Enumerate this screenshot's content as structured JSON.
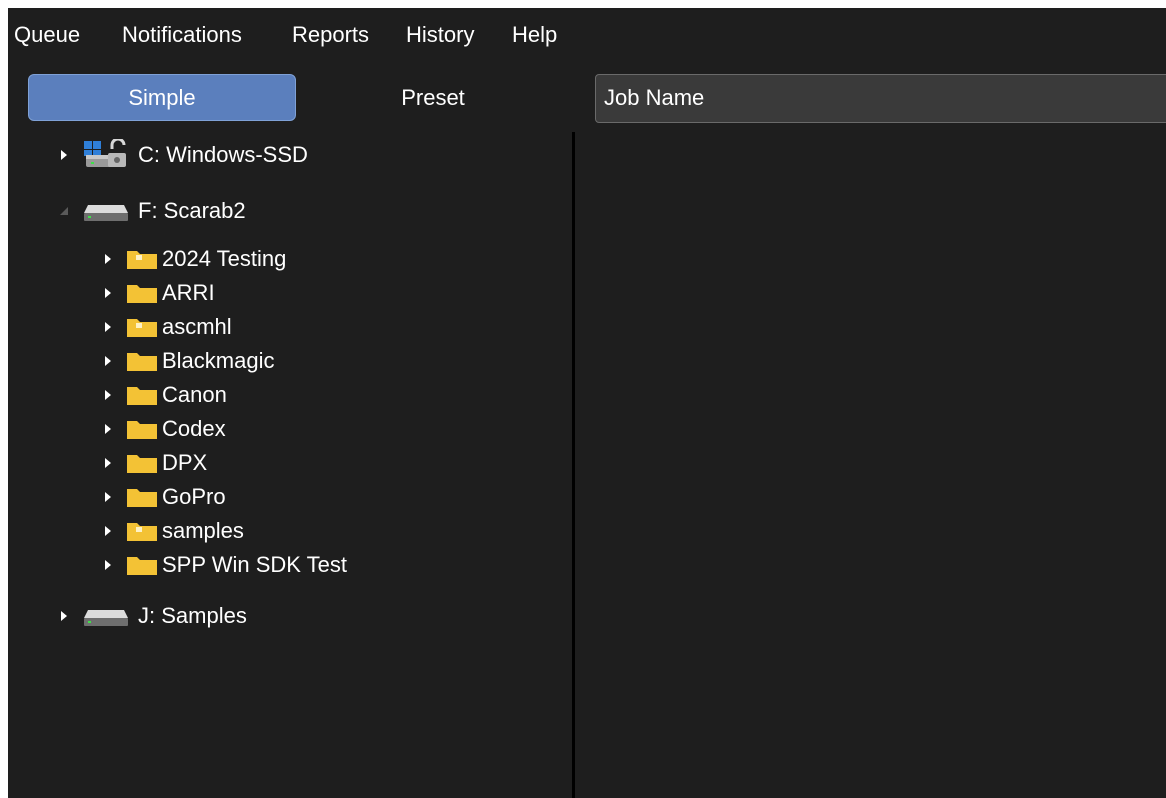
{
  "menu": {
    "items": [
      "Queue",
      "Notifications",
      "Reports",
      "History",
      "Help"
    ]
  },
  "toggle": {
    "simple_label": "Simple",
    "preset_label": "Preset",
    "selected": "Simple"
  },
  "job": {
    "header": "Job Name"
  },
  "tree": {
    "drives": [
      {
        "label": "C: Windows-SSD",
        "icon": "windows-drive-icon",
        "expanded": false
      },
      {
        "label": "F: Scarab2",
        "icon": "drive-icon",
        "expanded": true,
        "folders": [
          {
            "label": "2024 Testing",
            "icon": "folder-icon"
          },
          {
            "label": "ARRI",
            "icon": "folder-icon"
          },
          {
            "label": "ascmhl",
            "icon": "folder-icon"
          },
          {
            "label": "Blackmagic",
            "icon": "folder-icon"
          },
          {
            "label": "Canon",
            "icon": "folder-icon"
          },
          {
            "label": "Codex",
            "icon": "folder-icon"
          },
          {
            "label": "DPX",
            "icon": "folder-icon"
          },
          {
            "label": "GoPro",
            "icon": "folder-icon"
          },
          {
            "label": "samples",
            "icon": "folder-icon"
          },
          {
            "label": "SPP Win SDK Test",
            "icon": "folder-icon"
          }
        ]
      },
      {
        "label": "J: Samples",
        "icon": "drive-icon",
        "expanded": false
      }
    ]
  },
  "colors": {
    "background": "#1e1e1e",
    "accent": "#5b7fbd",
    "folder": "#f3c235"
  }
}
